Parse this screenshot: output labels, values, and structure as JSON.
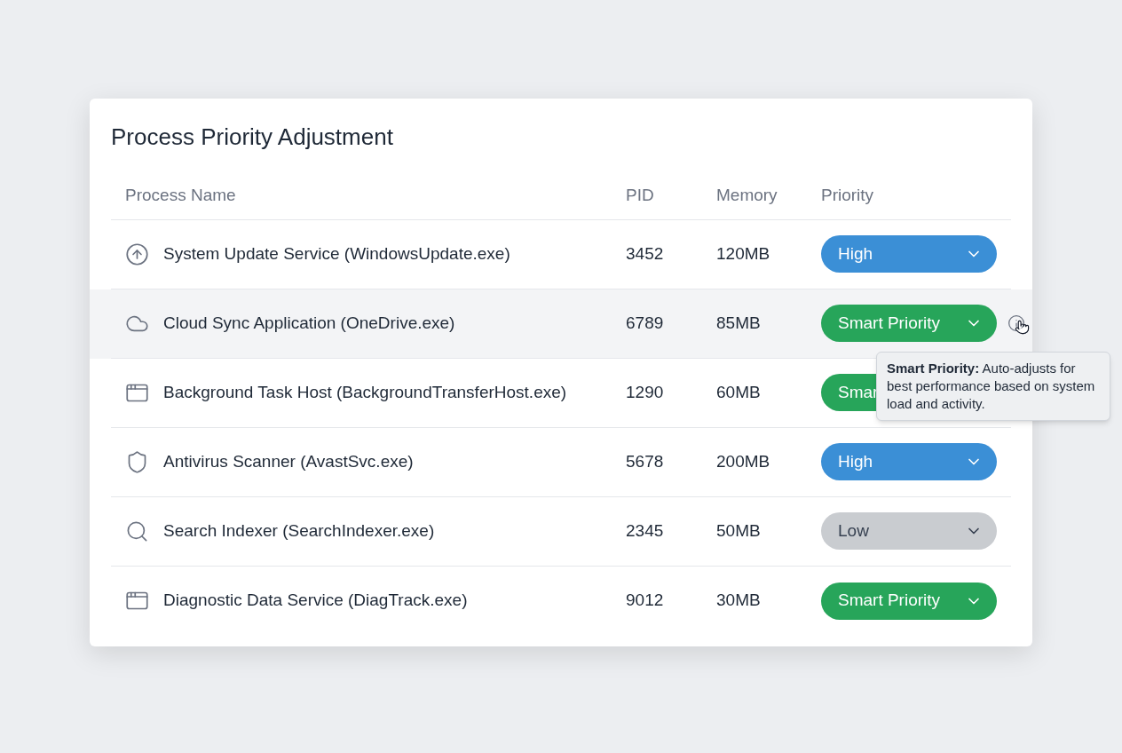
{
  "title": "Process Priority Adjustment",
  "columns": [
    "Process Name",
    "PID",
    "Memory",
    "Priority"
  ],
  "rows": [
    {
      "kind": "upload",
      "name": "System Update Service (WindowsUpdate.exe)",
      "pid": "3452",
      "memory": "120MB",
      "priority": {
        "kind": "high",
        "label": "High"
      },
      "hovered": false
    },
    {
      "kind": "cloud",
      "name": "Cloud Sync Application (OneDrive.exe)",
      "pid": "6789",
      "memory": "85MB",
      "priority": {
        "kind": "smart",
        "label": "Smart Priority"
      },
      "hovered": true
    },
    {
      "kind": "window",
      "name": "Background Task Host (BackgroundTransferHost.exe)",
      "pid": "1290",
      "memory": "60MB",
      "priority": {
        "kind": "smart",
        "label": "Smar"
      },
      "hovered": false
    },
    {
      "kind": "shield",
      "name": "Antivirus Scanner (AvastSvc.exe)",
      "pid": "5678",
      "memory": "200MB",
      "priority": {
        "kind": "high",
        "label": "High"
      },
      "hovered": false
    },
    {
      "kind": "search",
      "name": "Search Indexer (SearchIndexer.exe)",
      "pid": "2345",
      "memory": "50MB",
      "priority": {
        "kind": "low",
        "label": "Low"
      },
      "hovered": false
    },
    {
      "kind": "window",
      "name": "Diagnostic Data Service (DiagTrack.exe)",
      "pid": "9012",
      "memory": "30MB",
      "priority": {
        "kind": "smart",
        "label": "Smart Priority"
      },
      "hovered": false
    }
  ],
  "tooltip": {
    "text": "**Smart Priority:** Auto-adjusts for best performance based on system load and activity."
  }
}
